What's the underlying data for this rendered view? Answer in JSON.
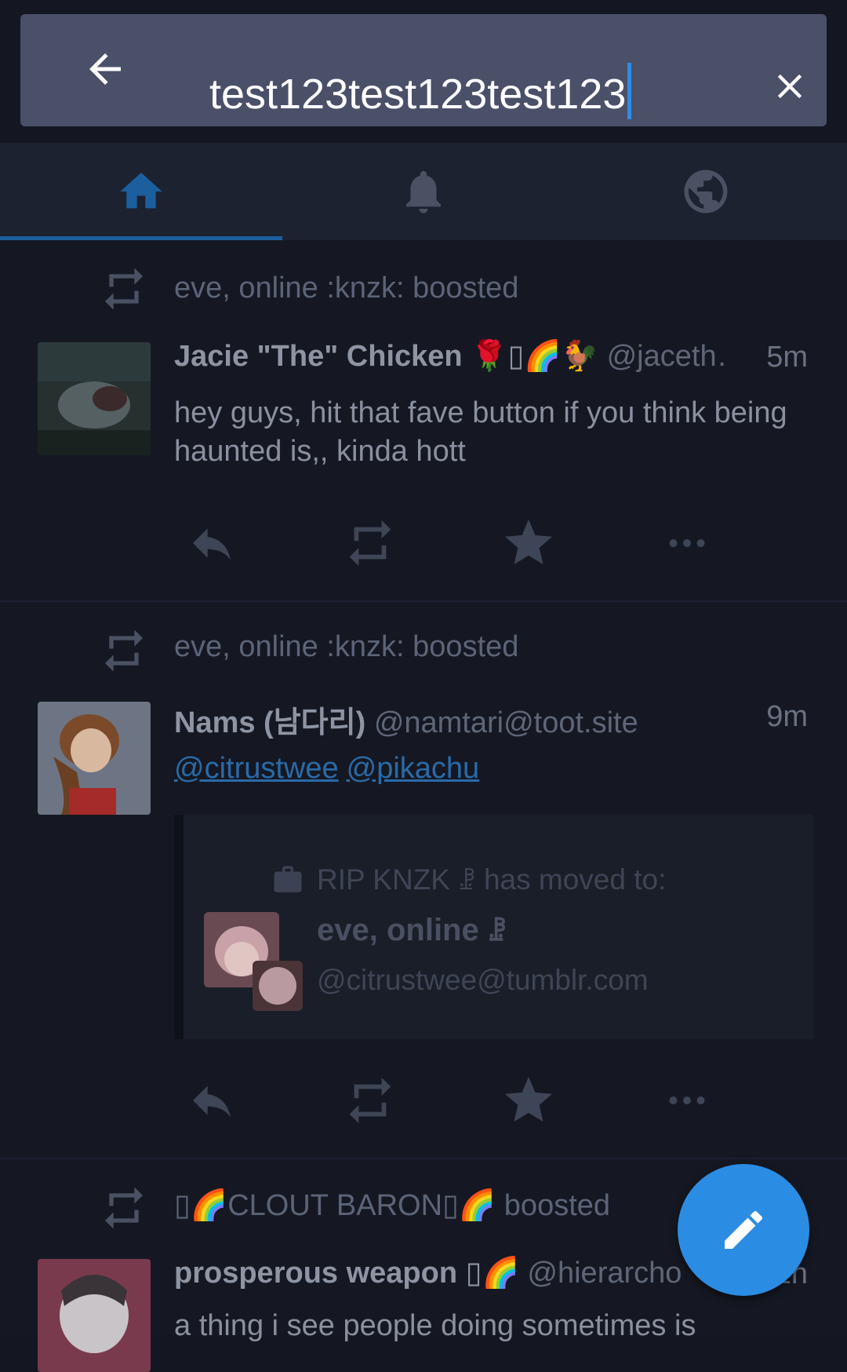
{
  "search": {
    "query": "test123test123test123",
    "back_icon": "arrow-left-icon",
    "clear_icon": "close-icon"
  },
  "tabs": [
    {
      "name": "home",
      "icon": "home-icon",
      "active": true
    },
    {
      "name": "notifications",
      "icon": "bell-icon",
      "active": false
    },
    {
      "name": "federated",
      "icon": "globe-icon",
      "active": false
    }
  ],
  "statuses": [
    {
      "boosted_by": "eve, online :knzk: boosted",
      "display_name": "Jacie \"The\" Chicken 🌹▯🌈🐓",
      "handle": "@jaceth…",
      "time": "5m",
      "content": "hey guys, hit that fave button if you think being haunted is,, kinda hott"
    },
    {
      "boosted_by": "eve, online :knzk: boosted",
      "display_name": "Nams (남다리)",
      "handle": "@namtari@toot.site",
      "time": "9m",
      "mentions": [
        "@citrustwee",
        "@pikachu"
      ],
      "moved_card": {
        "moved_text": "RIP KNZK ꗗ has moved to:",
        "account_name": "eve, online ꗗ",
        "account_handle": "@citrustwee@tumblr.com"
      }
    },
    {
      "boosted_by": "▯🌈CLOUT BARON▯🌈 boosted",
      "display_name": "prosperous weapon ▯🌈",
      "handle": "@hierarcho",
      "time": "2n",
      "content": "a thing i see people doing sometimes is"
    }
  ],
  "colors": {
    "accent": "#2b8ce3",
    "search_bg": "#4a5068",
    "background": "#151822"
  }
}
